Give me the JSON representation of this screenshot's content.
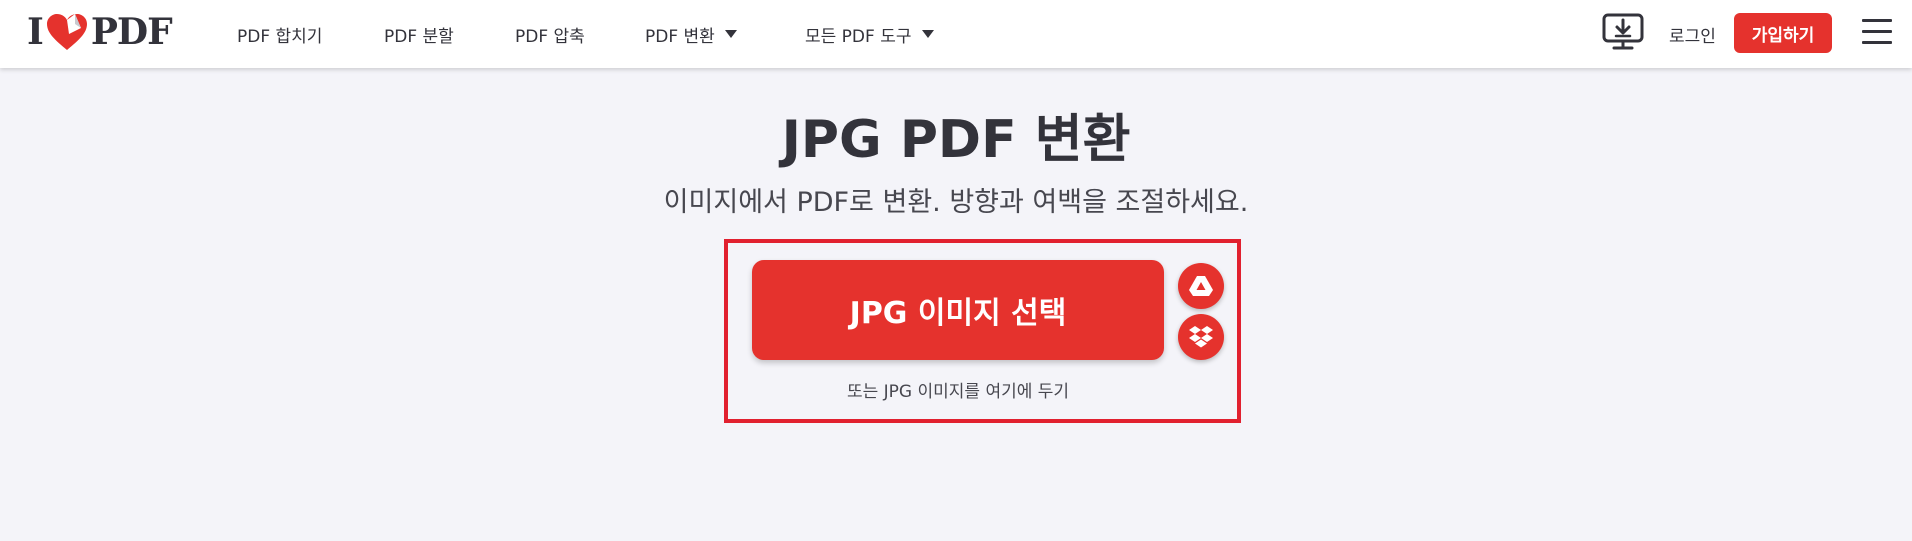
{
  "header": {
    "logo": {
      "text_left": "I",
      "text_right": "PDF",
      "icon": "heart-logo-icon"
    },
    "nav": [
      {
        "label": "PDF 합치기",
        "dropdown": false
      },
      {
        "label": "PDF 분할",
        "dropdown": false
      },
      {
        "label": "PDF 압축",
        "dropdown": false
      },
      {
        "label": "PDF 변환",
        "dropdown": true
      },
      {
        "label": "모든 PDF 도구",
        "dropdown": true
      }
    ],
    "desktop_icon": "desktop-download-icon",
    "login_label": "로그인",
    "signup_label": "가입하기",
    "menu_icon": "hamburger-menu-icon"
  },
  "main": {
    "title": "JPG PDF 변환",
    "subtitle": "이미지에서 PDF로 변환. 방향과 여백을 조절하세요.",
    "select_button_label": "JPG 이미지 선택",
    "google_drive_icon": "google-drive-icon",
    "dropbox_icon": "dropbox-icon",
    "drop_hint": "또는 JPG 이미지를 여기에 두기"
  },
  "colors": {
    "accent": "#e5322d",
    "highlight_border": "#e1202f",
    "text": "#33333b",
    "background": "#f4f4f9",
    "header_bg": "#ffffff"
  }
}
